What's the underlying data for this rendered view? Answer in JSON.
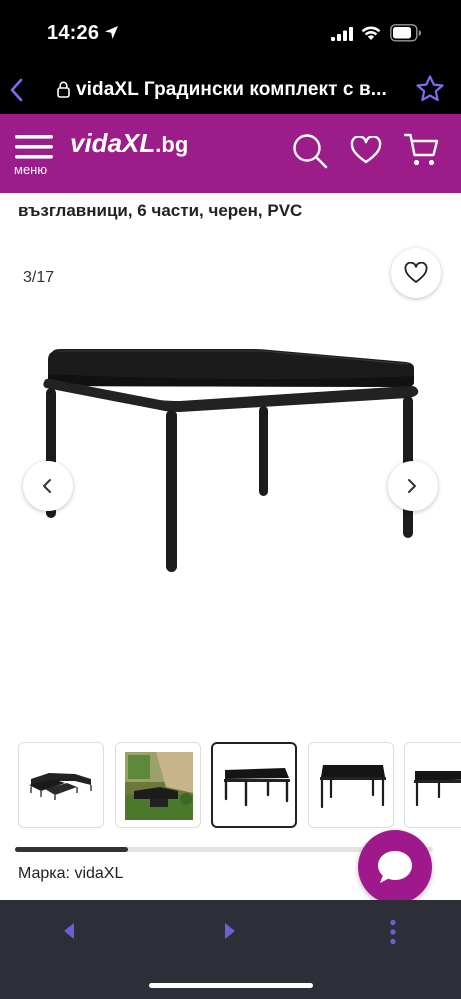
{
  "status_bar": {
    "time": "14:26"
  },
  "browser": {
    "address": "vidaXL Градински комплект с в..."
  },
  "header": {
    "menu_label": "меню",
    "logo": {
      "vida": "vida",
      "xl": "XL",
      "bg": ".bg"
    },
    "brand_color": "#9c1c8a"
  },
  "product": {
    "title_line": "възглавници, 6 части, черен, PVC",
    "image_counter": "3/17",
    "brand_label": "Марка: vidaXL"
  },
  "gallery": {
    "thumbnails": [
      {
        "name": "thumb-sofa-set"
      },
      {
        "name": "thumb-garden-scene"
      },
      {
        "name": "thumb-ottoman-front",
        "active": true
      },
      {
        "name": "thumb-ottoman-side"
      },
      {
        "name": "thumb-ottoman-partial"
      }
    ],
    "scroll_progress_fraction": 0.27
  },
  "colors": {
    "accent": "#9c1c8a",
    "chat": "#a0198c",
    "toolbar": "#2c2f38",
    "nav_arrow": "#7c5cd6"
  },
  "icons": [
    "location-arrow-icon",
    "signal-icon",
    "wifi-icon",
    "battery-icon",
    "back-chevron-icon",
    "lock-icon",
    "star-icon",
    "menu-icon",
    "search-icon",
    "heart-icon",
    "cart-icon",
    "chevron-left-icon",
    "chevron-right-icon",
    "chat-icon",
    "more-vertical-icon"
  ]
}
